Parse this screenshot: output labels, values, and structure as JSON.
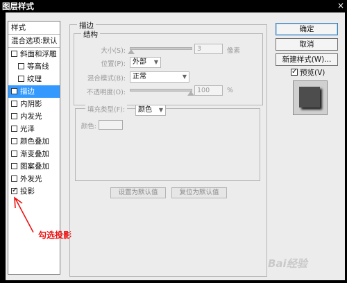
{
  "window": {
    "title": "图层样式",
    "close_glyph": "×"
  },
  "style_list": {
    "header": "样式",
    "blend_options": "混合选项:默认",
    "items": [
      {
        "label": "斜面和浮雕",
        "checked": false
      },
      {
        "label": "等高线",
        "checked": false
      },
      {
        "label": "纹理",
        "checked": false
      },
      {
        "label": "描边",
        "checked": false
      },
      {
        "label": "内阴影",
        "checked": false
      },
      {
        "label": "内发光",
        "checked": false
      },
      {
        "label": "光泽",
        "checked": false
      },
      {
        "label": "颜色叠加",
        "checked": false
      },
      {
        "label": "渐变叠加",
        "checked": false
      },
      {
        "label": "图案叠加",
        "checked": false
      },
      {
        "label": "外发光",
        "checked": false
      },
      {
        "label": "投影",
        "checked": true
      }
    ],
    "check_glyph": "✓"
  },
  "stroke_panel": {
    "title": "描边",
    "structure_title": "结构",
    "size_label": "大小(S):",
    "size_value": "3",
    "size_unit": "像素",
    "position_label": "位置(P):",
    "position_value": "外部",
    "blend_label": "混合模式(B):",
    "blend_value": "正常",
    "opacity_label": "不透明度(O):",
    "opacity_value": "100",
    "opacity_unit": "%",
    "fill_type_label": "填充类型(F):",
    "fill_type_value": "颜色",
    "color_label": "颜色:",
    "set_default": "设置为默认值",
    "reset_default": "复位为默认值"
  },
  "buttons": {
    "ok": "确定",
    "cancel": "取消",
    "new_style": "新建样式(W)...",
    "preview_label": "预览(V)",
    "preview_checked": true
  },
  "annotation": {
    "text": "勾选投影",
    "color": "#ee1111"
  },
  "watermark": {
    "text": "Bai经验"
  },
  "colors": {
    "selected": "#3399ff",
    "accent_red": "#ee1111"
  }
}
